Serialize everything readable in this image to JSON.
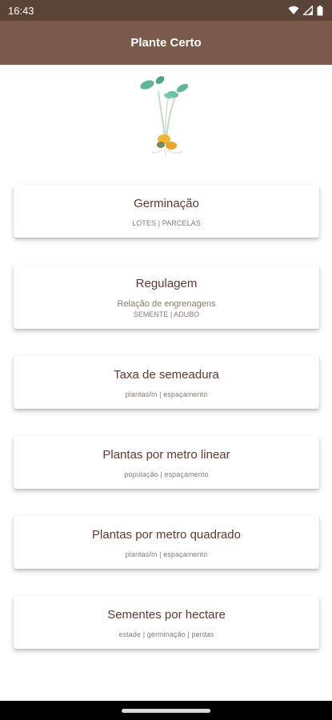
{
  "status_bar": {
    "time": "16:43",
    "icons": [
      "wifi-icon",
      "signal-icon",
      "battery-icon"
    ]
  },
  "app_bar": {
    "title": "Plante Certo"
  },
  "logo": {
    "icon": "sprout-icon"
  },
  "cards": [
    {
      "title": "Germinação",
      "subtitle": "LOTES | PARCELAS"
    },
    {
      "title": "Regulagem",
      "subtitle_line1": "Relação de engrenagens",
      "subtitle_line2": "SEMENTE | ADUBO"
    },
    {
      "title": "Taxa de semeadura",
      "subtitle": "plantas/m | espaçamento"
    },
    {
      "title": "Plantas por metro linear",
      "subtitle": "população | espaçamento"
    },
    {
      "title": "Plantas por metro quadrado",
      "subtitle": "plantas/m | espaçamento"
    },
    {
      "title": "Sementes por hectare",
      "subtitle": "estade | germinação | perdas"
    }
  ],
  "colors": {
    "status_bar": "#5b4337",
    "app_bar": "#7a5a4a",
    "card_title": "#5b3a30",
    "card_subtitle": "#8a7a74"
  }
}
